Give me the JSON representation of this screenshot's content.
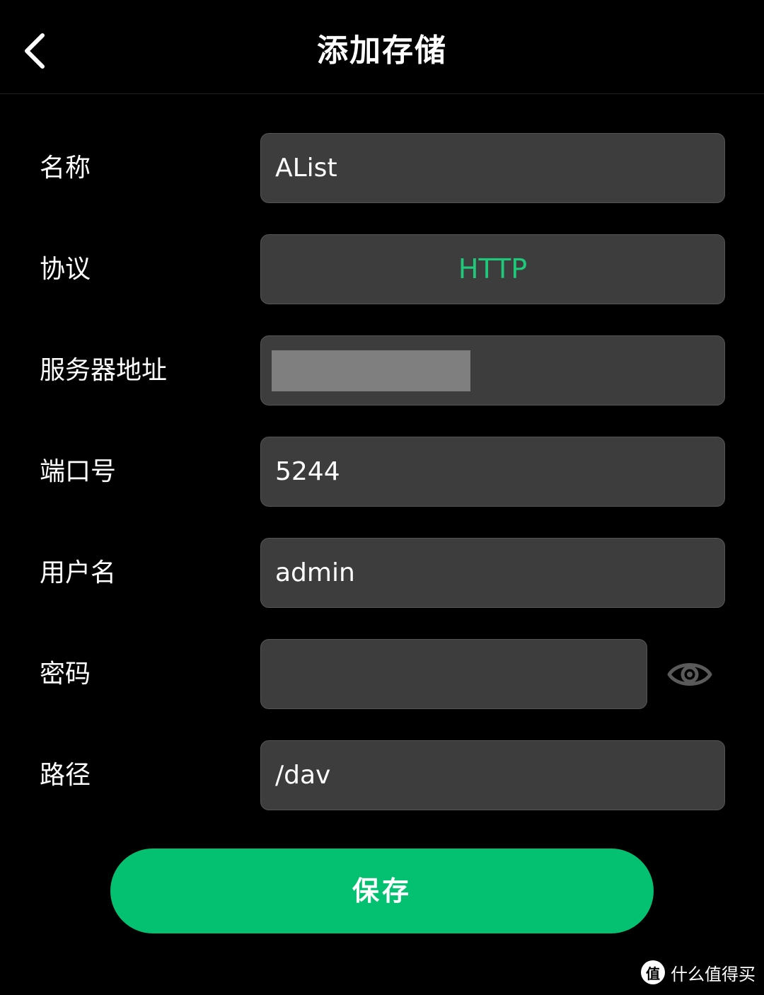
{
  "header": {
    "title": "添加存储"
  },
  "form": {
    "name": {
      "label": "名称",
      "value": "AList"
    },
    "protocol": {
      "label": "协议",
      "value": "HTTP"
    },
    "server": {
      "label": "服务器地址",
      "value": ""
    },
    "port": {
      "label": "端口号",
      "value": "5244"
    },
    "username": {
      "label": "用户名",
      "value": "admin"
    },
    "password": {
      "label": "密码",
      "value": ""
    },
    "path": {
      "label": "路径",
      "value": "/dav"
    }
  },
  "actions": {
    "save_label": "保存"
  },
  "watermark": {
    "logo": "值",
    "text": "什么值得买"
  },
  "colors": {
    "accent": "#04c172",
    "protocol_text": "#1ec97a",
    "field_bg": "#3d3d3d",
    "background": "#000000"
  },
  "icons": {
    "back": "chevron-left-icon",
    "password_toggle": "eye-icon"
  }
}
